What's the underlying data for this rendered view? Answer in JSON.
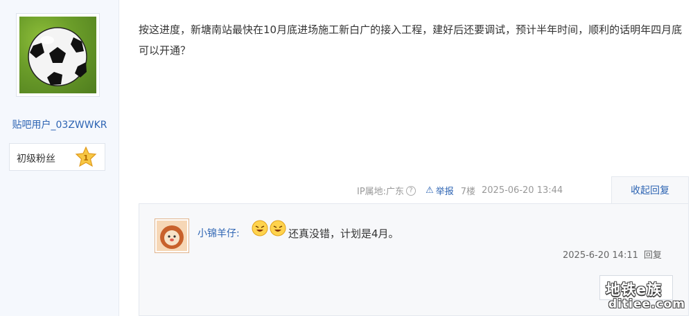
{
  "author": {
    "username": "贴吧用户_03ZWWKR",
    "level_title": "初级粉丝",
    "level_number": "1",
    "avatar_icon": "soccer-ball-avatar"
  },
  "post": {
    "content": "按这进度，新塘南站最快在10月底进场施工新白广的接入工程，建好后还要调试，预计半年时间，顺利的话明年四月底可以开通？",
    "ip_location": "IP属地:广东",
    "report_label": "举报",
    "floor": "7楼",
    "time": "2025-06-20 13:44",
    "collapse_label": "收起回复"
  },
  "replies": [
    {
      "username": "小锦羊仔:",
      "text": "还真没错，计划是4月。",
      "time": "2025-6-20 14:11",
      "reply_label": "回复",
      "avatar_icon": "lion-avatar",
      "emojis": [
        "laughing-emoji",
        "laughing-emoji"
      ]
    }
  ],
  "watermark": {
    "line1": "地铁e族",
    "line2": "ditiee.com"
  },
  "colors": {
    "link": "#2d64b3",
    "sidebar_bg": "#f5f8fd",
    "reply_bg": "#f7f8fa"
  }
}
